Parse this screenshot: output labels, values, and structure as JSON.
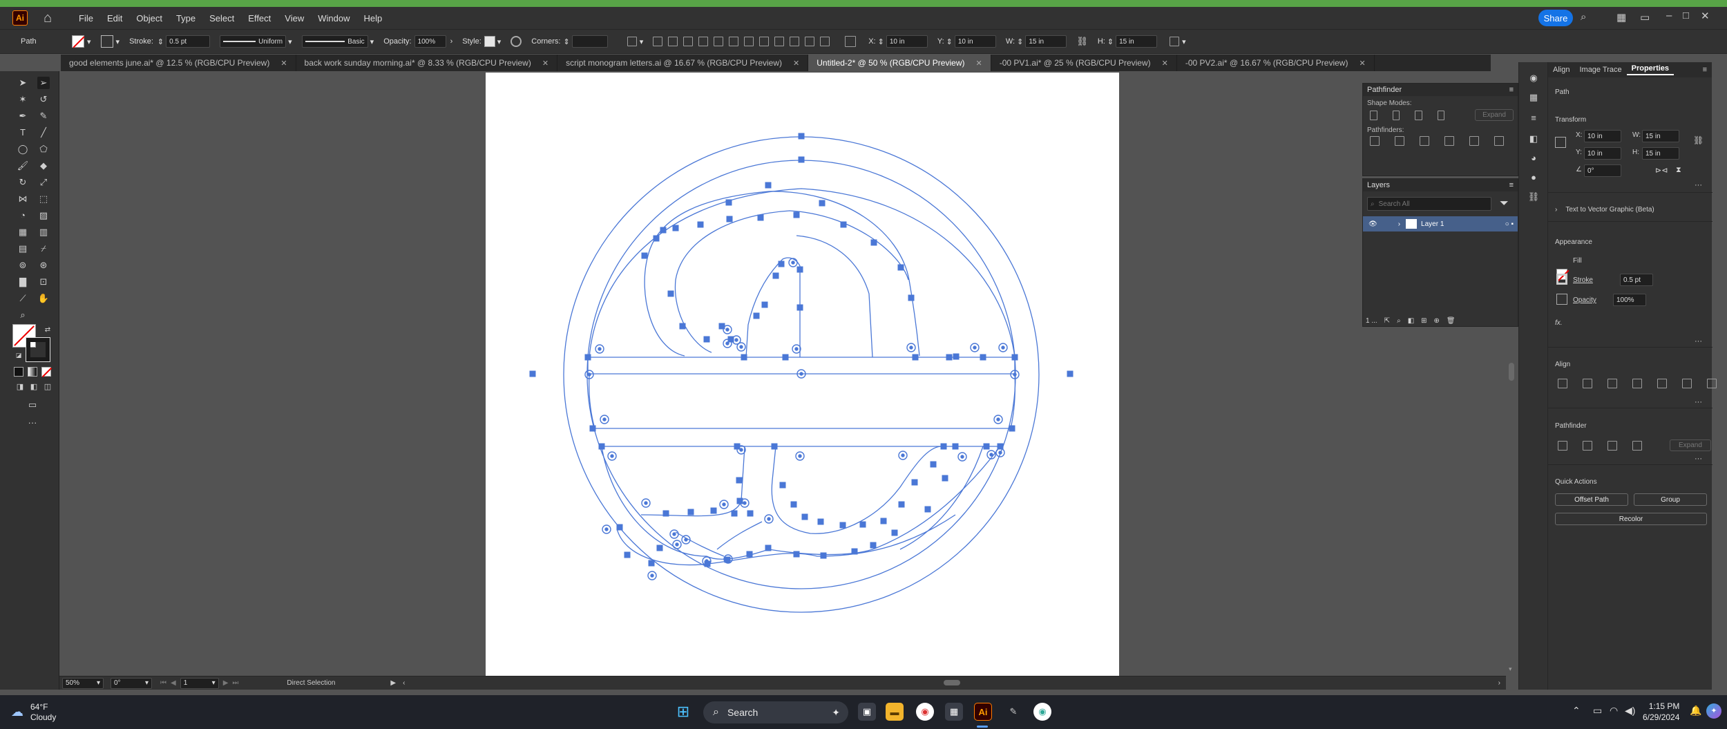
{
  "menubar": {
    "logo": "Ai",
    "items": [
      "File",
      "Edit",
      "Object",
      "Type",
      "Select",
      "Effect",
      "View",
      "Window",
      "Help"
    ],
    "share": "Share"
  },
  "control": {
    "kind": "Path",
    "stroke_label": "Stroke:",
    "stroke_value": "0.5 pt",
    "profile": "Uniform",
    "brush": "Basic",
    "opacity_label": "Opacity:",
    "opacity_value": "100%",
    "style_label": "Style:",
    "corners_label": "Corners:",
    "x_label": "X:",
    "x_value": "10 in",
    "y_label": "Y:",
    "y_value": "10 in",
    "w_label": "W:",
    "w_value": "15 in",
    "h_label": "H:",
    "h_value": "15 in"
  },
  "tabs": [
    {
      "label": "good elements june.ai* @ 12.5 % (RGB/CPU Preview)",
      "active": false
    },
    {
      "label": "back work sunday morning.ai* @ 8.33 % (RGB/CPU Preview)",
      "active": false
    },
    {
      "label": "script monogram letters.ai @ 16.67 % (RGB/CPU Preview)",
      "active": false
    },
    {
      "label": "Untitled-2* @ 50 % (RGB/CPU Preview)",
      "active": true
    },
    {
      "label": "-00 PV1.ai* @ 25 % (RGB/CPU Preview)",
      "active": false
    },
    {
      "label": "-00 PV2.ai* @ 16.67 % (RGB/CPU Preview)",
      "active": false
    }
  ],
  "pathfinder": {
    "title": "Pathfinder",
    "shape_modes": "Shape Modes:",
    "pathfinders": "Pathfinders:",
    "expand": "Expand"
  },
  "layers": {
    "title": "Layers",
    "search_placeholder": "Search All",
    "layer_name": "Layer 1",
    "count": "1 ..."
  },
  "properties": {
    "tabs": [
      "Align",
      "Image Trace",
      "Properties"
    ],
    "selection": "Path",
    "transform": "Transform",
    "x": "10 in",
    "y": "10 in",
    "w": "15 in",
    "h": "15 in",
    "angle": "0°",
    "text_to_vector": "Text to Vector Graphic (Beta)",
    "appearance": "Appearance",
    "fill": "Fill",
    "stroke": "Stroke",
    "stroke_value": "0.5 pt",
    "opacity": "Opacity",
    "opacity_value": "100%",
    "fx": "fx.",
    "align": "Align",
    "pathfinder": "Pathfinder",
    "expand": "Expand",
    "quick_actions": "Quick Actions",
    "offset_path": "Offset Path",
    "group": "Group",
    "recolor": "Recolor"
  },
  "status": {
    "zoom": "50%",
    "rotation": "0°",
    "artboard": "1",
    "tool": "Direct Selection"
  },
  "taskbar": {
    "temp": "64°F",
    "weather": "Cloudy",
    "search": "Search",
    "time": "1:15 PM",
    "date": "6/29/2024"
  },
  "colors": {
    "accent": "#1473e6",
    "path_blue": "#4a77d6"
  }
}
